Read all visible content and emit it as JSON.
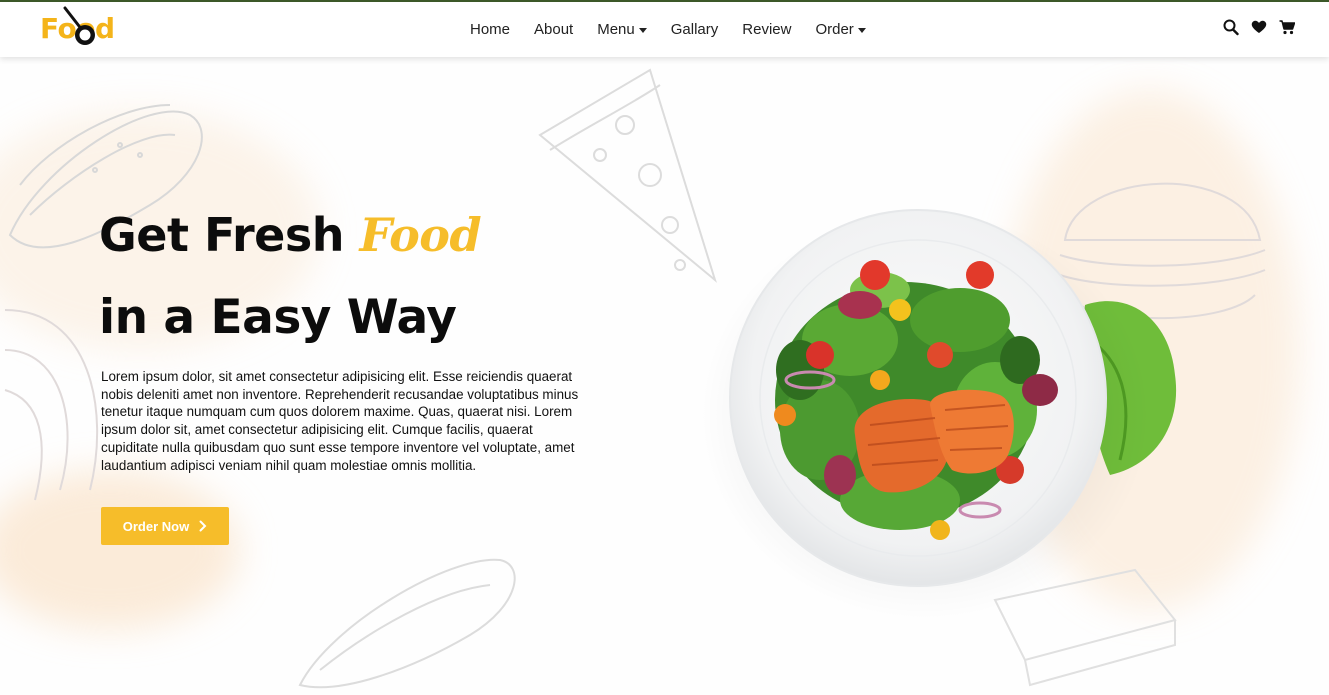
{
  "brand": {
    "logo_text": "Food",
    "accent_color": "#f6bd2a"
  },
  "nav": {
    "items": [
      {
        "label": "Home",
        "has_dropdown": false
      },
      {
        "label": "About",
        "has_dropdown": false
      },
      {
        "label": "Menu",
        "has_dropdown": true
      },
      {
        "label": "Gallary",
        "has_dropdown": false
      },
      {
        "label": "Review",
        "has_dropdown": false
      },
      {
        "label": "Order",
        "has_dropdown": true
      }
    ],
    "icons": [
      "search-icon",
      "heart-icon",
      "cart-icon"
    ]
  },
  "hero": {
    "title_prefix": "Get Fresh",
    "title_accent": "Food",
    "title_line2": "in a Easy Way",
    "description": "Lorem ipsum dolor, sit amet consectetur adipisicing elit. Esse reiciendis quaerat nobis deleniti amet non inventore. Reprehenderit recusandae voluptatibus minus tenetur itaque numquam cum quos dolorem maxime. Quas, quaerat nisi. Lorem ipsum dolor sit, amet consectetur adipisicing elit. Cumque facilis, quaerat cupiditate nulla quibusdam quo sunt esse tempore inventore vel voluptate, amet laudantium adipisci veniam nihil quam molestiae omnis mollitia.",
    "cta_label": "Order Now",
    "image": "salmon-salad-plate"
  }
}
